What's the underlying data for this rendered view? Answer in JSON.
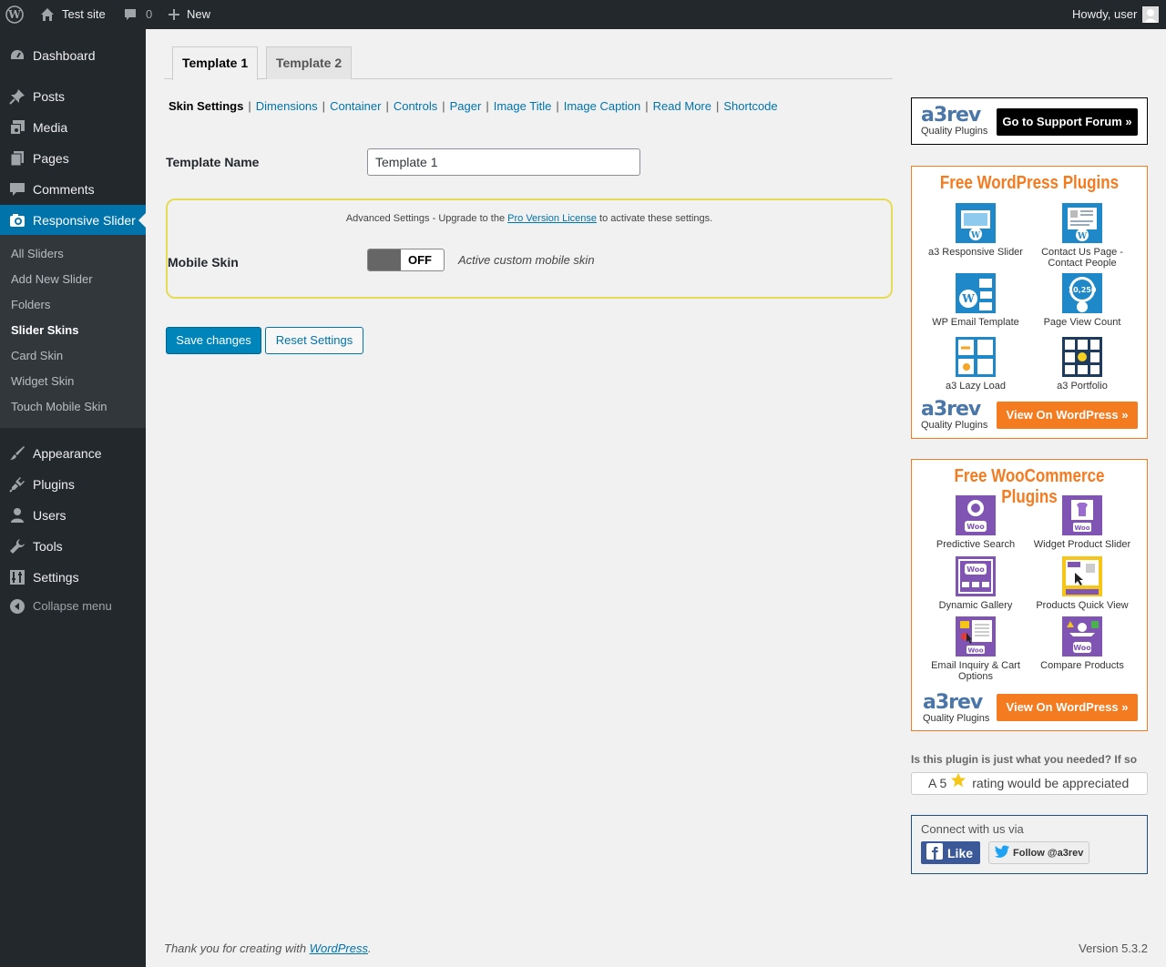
{
  "adminbar": {
    "site_name": "Test site",
    "comments_count": "0",
    "new_label": "New",
    "howdy": "Howdy, user"
  },
  "menu": {
    "items": [
      {
        "label": "Dashboard",
        "icon": "dashboard-icon"
      },
      {
        "label": "Posts",
        "icon": "pin-icon"
      },
      {
        "label": "Media",
        "icon": "media-icon"
      },
      {
        "label": "Pages",
        "icon": "pages-icon"
      },
      {
        "label": "Comments",
        "icon": "comment-icon"
      },
      {
        "label": "Responsive Slider",
        "icon": "camera-icon"
      },
      {
        "label": "Appearance",
        "icon": "brush-icon"
      },
      {
        "label": "Plugins",
        "icon": "plug-icon"
      },
      {
        "label": "Users",
        "icon": "user-icon"
      },
      {
        "label": "Tools",
        "icon": "wrench-icon"
      },
      {
        "label": "Settings",
        "icon": "settings-icon"
      }
    ],
    "submenu": [
      "All Sliders",
      "Add New Slider",
      "Folders",
      "Slider Skins",
      "Card Skin",
      "Widget Skin",
      "Touch Mobile Skin"
    ],
    "collapse": "Collapse menu"
  },
  "tabs": [
    "Template 1",
    "Template 2"
  ],
  "subnav": [
    "Skin Settings",
    "Dimensions",
    "Container",
    "Controls",
    "Pager",
    "Image Title",
    "Image Caption",
    "Read More",
    "Shortcode"
  ],
  "form": {
    "template_name_label": "Template Name",
    "template_name_value": "Template 1",
    "pro_note_before": "Advanced Settings - Upgrade to the ",
    "pro_note_link": "Pro Version License",
    "pro_note_after": " to activate these settings.",
    "mobile_skin_label": "Mobile Skin",
    "toggle_state": "OFF",
    "toggle_desc": "Active custom mobile skin",
    "save": "Save changes",
    "reset": "Reset Settings"
  },
  "sidebar": {
    "logo_text": "a3rev",
    "logo_sub": "Quality Plugins",
    "support_btn": "Go to Support Forum",
    "wp_title": "Free WordPress Plugins",
    "wp_plugins": [
      "a3 Responsive Slider",
      "Contact Us Page - Contact People",
      "WP Email Template",
      "Page View Count",
      "a3 Lazy Load",
      "a3 Portfolio"
    ],
    "view_btn": "View On WordPress",
    "woo_title": "Free WooCommerce Plugins",
    "woo_plugins": [
      "Predictive Search",
      "Widget Product Slider",
      "Dynamic Gallery",
      "Products Quick View",
      "Email Inquiry & Cart Options",
      "Compare Products"
    ],
    "rate_question": "Is this plugin is just what you needed? If so",
    "rate_before": "A 5",
    "rate_after": "rating would be appreciated",
    "connect": "Connect with us via",
    "fb_like": "Like",
    "tw_follow": "Follow @a3rev"
  },
  "footer": {
    "before": "Thank you for creating with ",
    "link": "WordPress",
    "after": ".",
    "version": "Version 5.3.2"
  },
  "colors": {
    "accent": "#0073aa",
    "admin_dark": "#23282d",
    "orange": "#f47b20",
    "woo_purple": "#7f54b3"
  }
}
